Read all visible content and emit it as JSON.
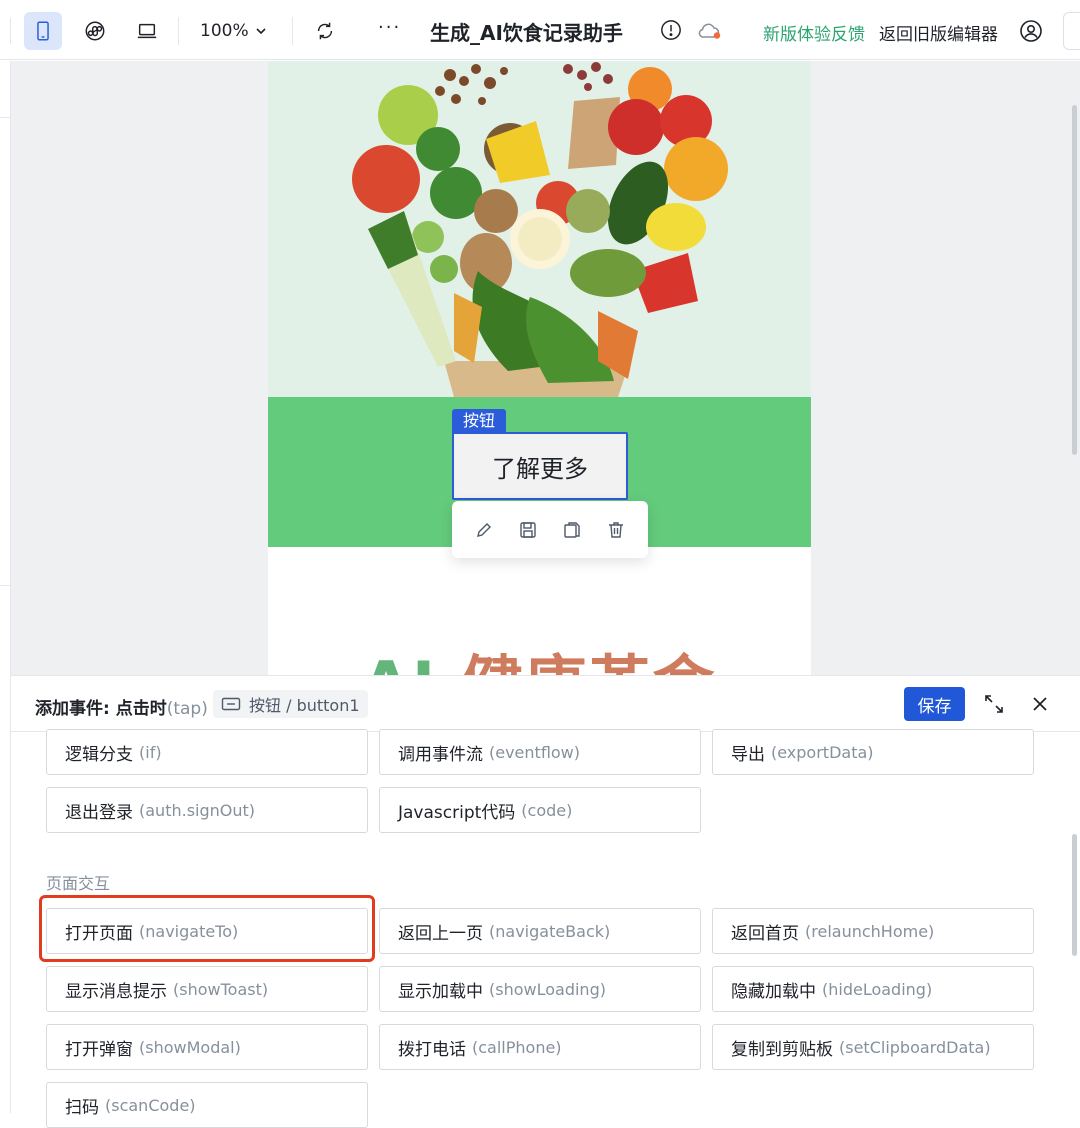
{
  "toolbar": {
    "zoom": "100%",
    "more": "···",
    "app_title": "生成_AI饮食记录助手",
    "feedback": "新版体验反馈",
    "old_editor": "返回旧版编辑器"
  },
  "canvas": {
    "component_tag": "按钮",
    "button_label": "了解更多",
    "headline_part1": "AI ",
    "headline_part2": "健康革命"
  },
  "panel": {
    "title": "添加事件: 点击时",
    "trigger": "(tap)",
    "component": "按钮 / button1",
    "save": "保存",
    "section_title": "页面交互",
    "actions_top": [
      {
        "label": "逻辑分支",
        "api": "(if)"
      },
      {
        "label": "调用事件流",
        "api": "(eventflow)"
      },
      {
        "label": "导出",
        "api": "(exportData)"
      },
      {
        "label": "退出登录",
        "api": "(auth.signOut)"
      },
      {
        "label": "Javascript代码",
        "api": "(code)"
      }
    ],
    "actions_page": [
      {
        "label": "打开页面",
        "api": "(navigateTo)"
      },
      {
        "label": "返回上一页",
        "api": "(navigateBack)"
      },
      {
        "label": "返回首页",
        "api": "(relaunchHome)"
      },
      {
        "label": "显示消息提示",
        "api": "(showToast)"
      },
      {
        "label": "显示加载中",
        "api": "(showLoading)"
      },
      {
        "label": "隐藏加载中",
        "api": "(hideLoading)"
      },
      {
        "label": "打开弹窗",
        "api": "(showModal)"
      },
      {
        "label": "拨打电话",
        "api": "(callPhone)"
      },
      {
        "label": "复制到剪贴板",
        "api": "(setClipboardData)"
      },
      {
        "label": "扫码",
        "api": "(scanCode)"
      }
    ]
  },
  "colors": {
    "accent": "#2158d8",
    "highlight": "#e33b20",
    "feedback_green": "#2ba471",
    "band_green": "#63cb7c"
  },
  "icons": [
    "mobile-icon",
    "wechat-miniprogram-icon",
    "laptop-icon",
    "chevron-down-icon",
    "refresh-icon",
    "info-icon",
    "cloud-icon",
    "user-icon",
    "edit-icon",
    "save-icon",
    "copy-icon",
    "delete-icon",
    "button-component-icon",
    "expand-icon",
    "close-icon"
  ]
}
